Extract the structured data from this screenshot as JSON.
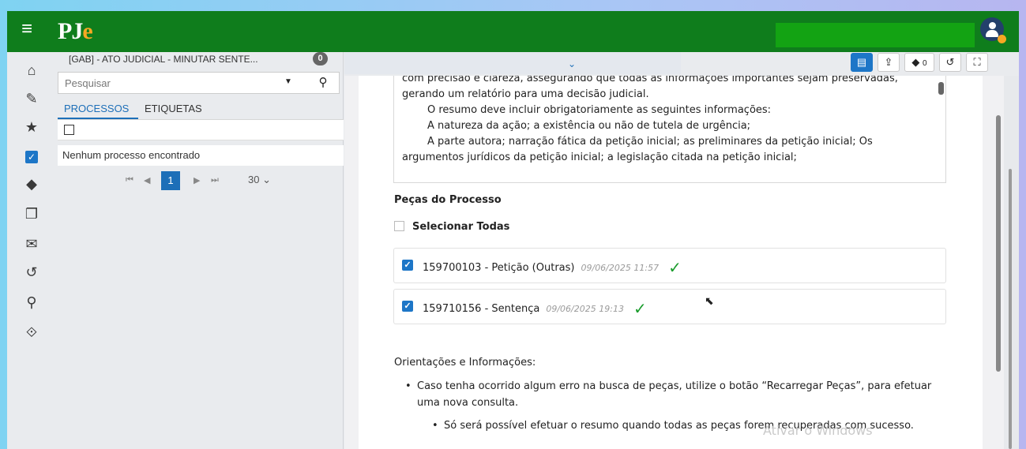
{
  "app": {
    "logo_p": "PJ",
    "logo_e": "e"
  },
  "panel": {
    "title": "[GAB] - ATO JUDICIAL - MINUTAR SENTE...",
    "count": "0",
    "search_placeholder": "Pesquisar",
    "tabs": [
      "PROCESSOS",
      "ETIQUETAS"
    ],
    "empty_text": "Nenhum processo encontrado",
    "pager": {
      "current": "1",
      "page_size": "30"
    }
  },
  "toolbar": {
    "tags_count": "0"
  },
  "summary_text": [
    "com precisão e clareza, assegurando que todas as informações importantes sejam preservadas,",
    "gerando um relatório para uma decisão judicial.",
    "O resumo deve incluir obrigatoriamente as seguintes informações:",
    "A natureza da ação; a existência ou não de tutela de urgência;",
    "A parte autora; narração fática da petição inicial; as preliminares da petição inicial; Os",
    "argumentos jurídicos da petição inicial; a legislação citada na petição inicial;"
  ],
  "pieces": {
    "heading": "Peças do Processo",
    "select_all": "Selecionar Todas",
    "items": [
      {
        "label": "159700103 - Petição (Outras)",
        "date": "09/06/2025 11:57"
      },
      {
        "label": "159710156 - Sentença",
        "date": "09/06/2025 19:13"
      }
    ]
  },
  "orientations": {
    "heading": "Orientações e Informações:",
    "bullet1_line1": "Caso tenha ocorrido algum erro na busca de peças, utilize o botão “Recarregar Peças”, para efetuar",
    "bullet1_line2": "uma nova consulta.",
    "bullet2": "Só será possível efetuar o resumo quando todas as peças forem recuperadas com sucesso."
  },
  "watermark": "Ativar o Windows",
  "colors": {
    "topbar": "#0f7d1c",
    "accent": "#1d76c7",
    "ok": "#1a9c2c",
    "logo_e": "#f7a823"
  }
}
